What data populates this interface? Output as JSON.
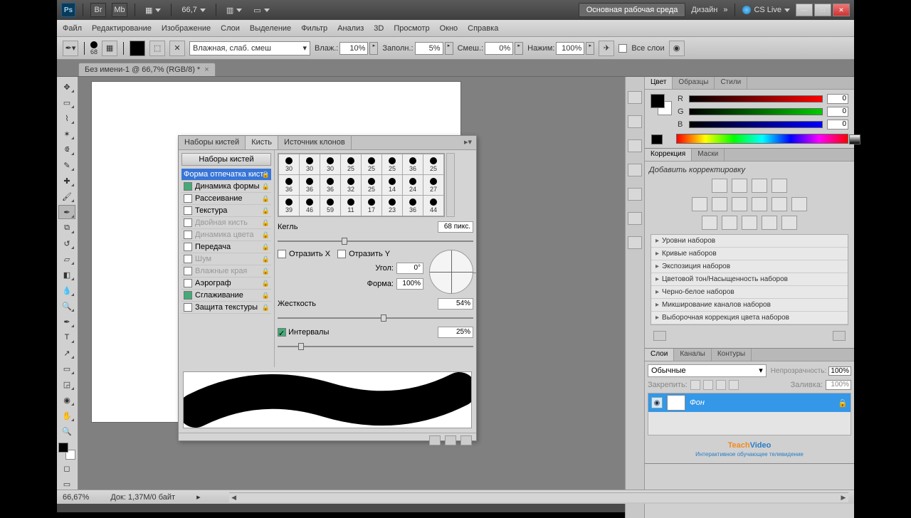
{
  "topbar": {
    "zoom": "66,7",
    "workspace": "Основная рабочая среда",
    "design": "Дизайн",
    "cslive": "CS Live"
  },
  "menu": [
    "Файл",
    "Редактирование",
    "Изображение",
    "Слои",
    "Выделение",
    "Фильтр",
    "Анализ",
    "3D",
    "Просмотр",
    "Окно",
    "Справка"
  ],
  "options": {
    "brushSize": "68",
    "preset": "Влажная, слаб. смеш",
    "wet_label": "Влаж.:",
    "wet": "10%",
    "load_label": "Заполн.:",
    "load": "5%",
    "mix_label": "Смеш.:",
    "mix": "0%",
    "flow_label": "Нажим:",
    "flow": "100%",
    "alllayers": "Все слои"
  },
  "doc": {
    "title": "Без имени-1 @ 66,7% (RGB/8) *"
  },
  "status": {
    "zoom": "66,67%",
    "doc": "Док: 1,37M/0 байт"
  },
  "brushPanel": {
    "tabs": [
      "Наборы кистей",
      "Кисть",
      "Источник клонов"
    ],
    "presetsBtn": "Наборы кистей",
    "items": [
      {
        "label": "Форма отпечатка кисти",
        "hl": true
      },
      {
        "label": "Динамика формы",
        "chk": true
      },
      {
        "label": "Рассеивание"
      },
      {
        "label": "Текстура"
      },
      {
        "label": "Двойная кисть",
        "gray": true
      },
      {
        "label": "Динамика цвета",
        "gray": true
      },
      {
        "label": "Передача"
      },
      {
        "label": "Шум",
        "gray": true
      },
      {
        "label": "Влажные края",
        "gray": true
      },
      {
        "label": "Аэрограф"
      },
      {
        "label": "Сглаживание",
        "chk": true
      },
      {
        "label": "Защита текстуры"
      }
    ],
    "grid": [
      30,
      30,
      30,
      25,
      25,
      25,
      36,
      25,
      36,
      36,
      36,
      32,
      25,
      14,
      24,
      27,
      39,
      46,
      59,
      11,
      17,
      23,
      36,
      44
    ],
    "size_label": "Кегль",
    "size_val": "68 пикс.",
    "flipX": "Отразить X",
    "flipY": "Отразить Y",
    "angle_label": "Угол:",
    "angle_val": "0°",
    "round_label": "Форма:",
    "round_val": "100%",
    "hardness_label": "Жесткость",
    "hardness_val": "54%",
    "spacing_label": "Интервалы",
    "spacing_val": "25%"
  },
  "colorPanel": {
    "tabs": [
      "Цвет",
      "Образцы",
      "Стили"
    ],
    "r": "0",
    "g": "0",
    "b": "0"
  },
  "adjPanel": {
    "tabs": [
      "Коррекция",
      "Маски"
    ],
    "title": "Добавить корректировку",
    "presets": [
      "Уровни наборов",
      "Кривые наборов",
      "Экспозиция наборов",
      "Цветовой тон/Насыщенность наборов",
      "Черно-белое наборов",
      "Микширование каналов наборов",
      "Выборочная коррекция цвета наборов"
    ]
  },
  "layersPanel": {
    "tabs": [
      "Слои",
      "Каналы",
      "Контуры"
    ],
    "mode": "Обычные",
    "opacity_label": "Непрозрачность:",
    "opacity": "100%",
    "lock_label": "Закрепить:",
    "fill_label": "Заливка:",
    "fill": "100%",
    "layer": "Фон"
  },
  "logo": {
    "a": "Teach",
    "b": "Video",
    "sub": "Интерактивное обучающее телевидение"
  }
}
